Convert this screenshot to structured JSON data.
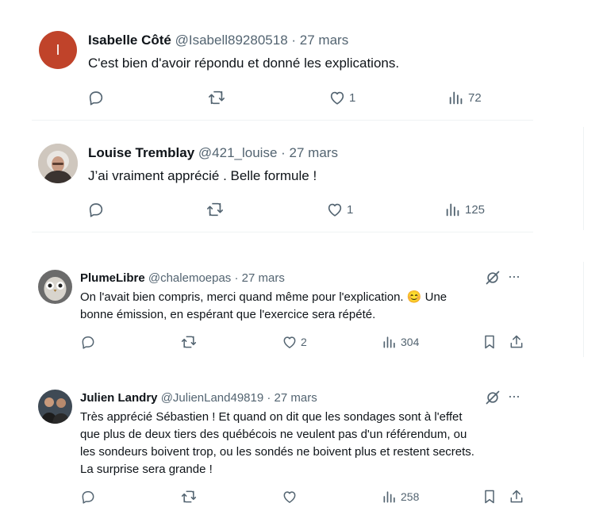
{
  "tweets": [
    {
      "name": "Isabelle Côté",
      "handle": "@Isabell89280518",
      "separator": "·",
      "date": "27 mars",
      "avatar_letter": "I",
      "avatar_color": "#c0432a",
      "text": "C'est bien d'avoir répondu et donné les explications.",
      "likes": "1",
      "views": "72"
    },
    {
      "name": "Louise Tremblay",
      "handle": "@421_louise",
      "separator": "·",
      "date": "27 mars",
      "text": "J’ai vraiment apprécié . Belle formule !",
      "likes": "1",
      "views": "125"
    },
    {
      "name": "PlumeLibre",
      "handle": "@chalemoepas",
      "separator": "·",
      "date": "27 mars",
      "text_line1": "On l'avait bien compris, merci quand même pour l'explication.",
      "emoji": "😊",
      "text_line1_end": "Une",
      "text_line2": "bonne émission, en espérant que l'exercice sera répété.",
      "likes": "2",
      "views": "304"
    },
    {
      "name": "Julien Landry",
      "handle": "@JulienLand49819",
      "separator": "·",
      "date": "27 mars",
      "lines": [
        "Très apprécié Sébastien ! Et quand on dit que les sondages sont à l'effet",
        "que plus de deux tiers des québécois ne veulent pas d'un référendum, ou",
        "les sondeurs boivent trop, ou les sondés ne boivent plus et restent secrets.",
        "La surprise sera grande !"
      ],
      "likes": "",
      "views": "258"
    }
  ],
  "more_label": "···"
}
